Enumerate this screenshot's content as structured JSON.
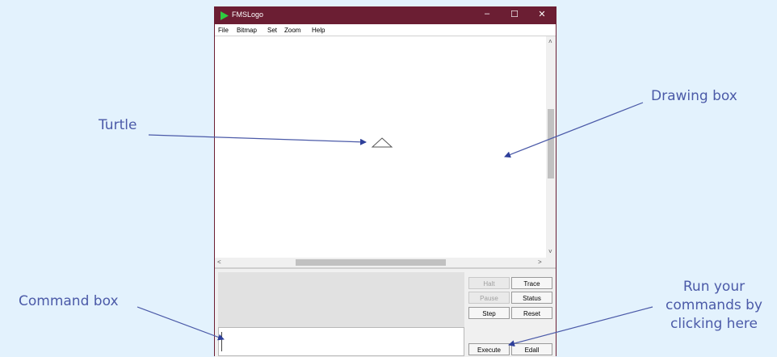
{
  "window": {
    "title": "FMSLogo",
    "controls": {
      "minimize": "–",
      "maximize": "☐",
      "close": "✕"
    }
  },
  "menu": {
    "items": [
      "File",
      "Bitmap",
      "Set",
      "Zoom",
      "Help"
    ]
  },
  "scrollbars": {
    "up": "˄",
    "down": "˅",
    "left": "<",
    "right": ">"
  },
  "buttons": {
    "halt": "Halt",
    "trace": "Trace",
    "pause": "Pause",
    "status": "Status",
    "step": "Step",
    "reset": "Reset",
    "execute": "Execute",
    "edall": "Edall"
  },
  "annotations": {
    "turtle": "Turtle",
    "drawing_box": "Drawing box",
    "command_box": "Command box",
    "run_line1": "Run your",
    "run_line2": "commands by",
    "run_line3": "clicking here"
  },
  "colors": {
    "background": "#e3f2fd",
    "titlebar": "#6b1e33",
    "annotation": "#4b5aa8",
    "app_icon": "#2ecc40"
  },
  "icons": {
    "app": "fmslogo-play-icon",
    "turtle": "turtle-triangle-icon"
  }
}
